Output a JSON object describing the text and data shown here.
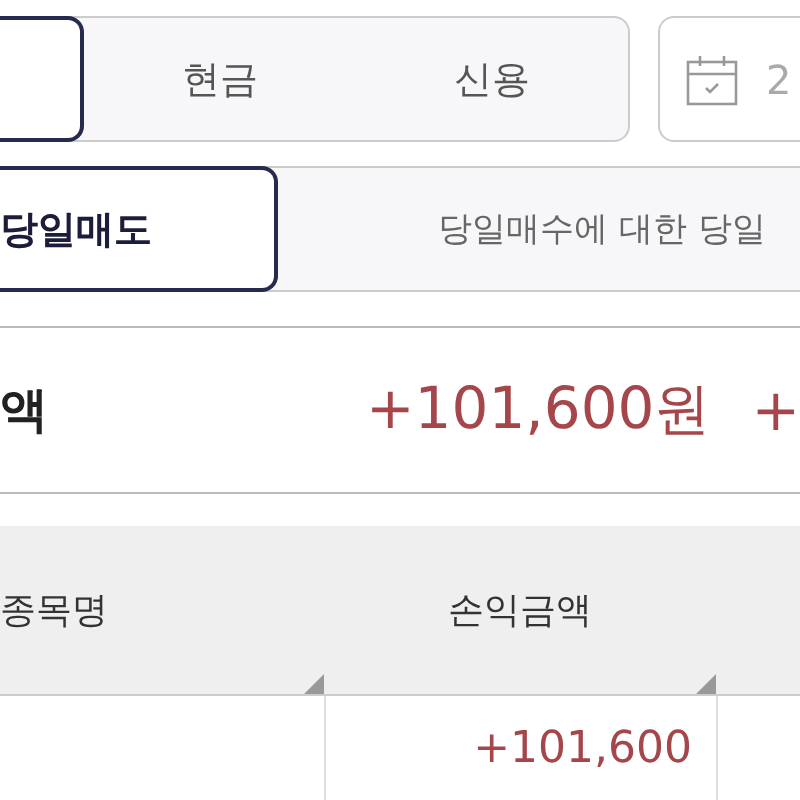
{
  "account_tabs": [
    {
      "selected": true
    },
    {
      "label": "현금",
      "selected": false
    },
    {
      "label": "신용",
      "selected": false
    }
  ],
  "date_field": {
    "value": "2"
  },
  "trade_tabs": [
    {
      "label": "당일매도",
      "selected": true
    },
    {
      "label": "당일매수에 대한 당일",
      "selected": false
    }
  ],
  "summary": {
    "label": "액",
    "amount": "+101,600",
    "unit": "원",
    "next_amount": "+"
  },
  "table": {
    "columns": [
      "종목명",
      "손익금액"
    ],
    "rows": [
      {
        "profit": "+101,600"
      }
    ]
  }
}
